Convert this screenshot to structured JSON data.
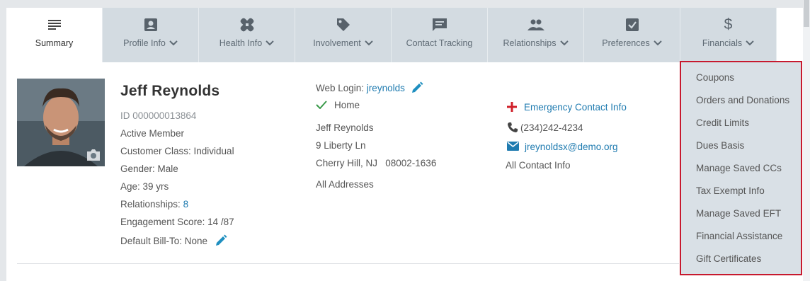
{
  "tabs": [
    {
      "label": "Summary",
      "icon": "summary-lines-icon",
      "active": true,
      "dropdown": false
    },
    {
      "label": "Profile Info",
      "icon": "profile-card-icon",
      "active": false,
      "dropdown": true
    },
    {
      "label": "Health Info",
      "icon": "bandage-icon",
      "active": false,
      "dropdown": true
    },
    {
      "label": "Involvement",
      "icon": "tag-icon",
      "active": false,
      "dropdown": true
    },
    {
      "label": "Contact Tracking",
      "icon": "chat-bubble-icon",
      "active": false,
      "dropdown": false
    },
    {
      "label": "Relationships",
      "icon": "people-icon",
      "active": false,
      "dropdown": true
    },
    {
      "label": "Preferences",
      "icon": "checkbox-icon",
      "active": false,
      "dropdown": true
    },
    {
      "label": "Financials",
      "icon": "dollar-icon",
      "active": false,
      "dropdown": true
    }
  ],
  "member": {
    "name": "Jeff Reynolds",
    "id": "ID 000000013864",
    "status": "Active Member",
    "customer_class": "Customer Class: Individual",
    "gender": "Gender: Male",
    "age": "Age: 39 yrs",
    "relationships_label": "Relationships: ",
    "relationships_count": "8",
    "engagement": "Engagement Score: 14 /87",
    "bill_to": "Default Bill-To: None"
  },
  "login": {
    "label": "Web Login: ",
    "value": "jreynolds"
  },
  "address": {
    "type": "Home",
    "line1": "Jeff Reynolds",
    "line2": "9 Liberty Ln",
    "line3": "Cherry Hill, NJ   08002-1636",
    "all_link": "All Addresses"
  },
  "contact": {
    "emergency": "Emergency Contact Info",
    "phone": "(234)242-4234",
    "email": "jreynoldsx@demo.org",
    "all_link": "All Contact Info"
  },
  "financials_menu": [
    "Coupons",
    "Orders and Donations",
    "Credit Limits",
    "Dues Basis",
    "Manage Saved CCs",
    "Tax Exempt Info",
    "Manage Saved EFT",
    "Financial Assistance",
    "Gift Certificates"
  ],
  "colors": {
    "link": "#1f7bb0",
    "tab_bg": "#d3dbe1",
    "menu_border": "#c7192e",
    "emergency_red": "#d0202a",
    "check_green": "#3a9a4a"
  }
}
